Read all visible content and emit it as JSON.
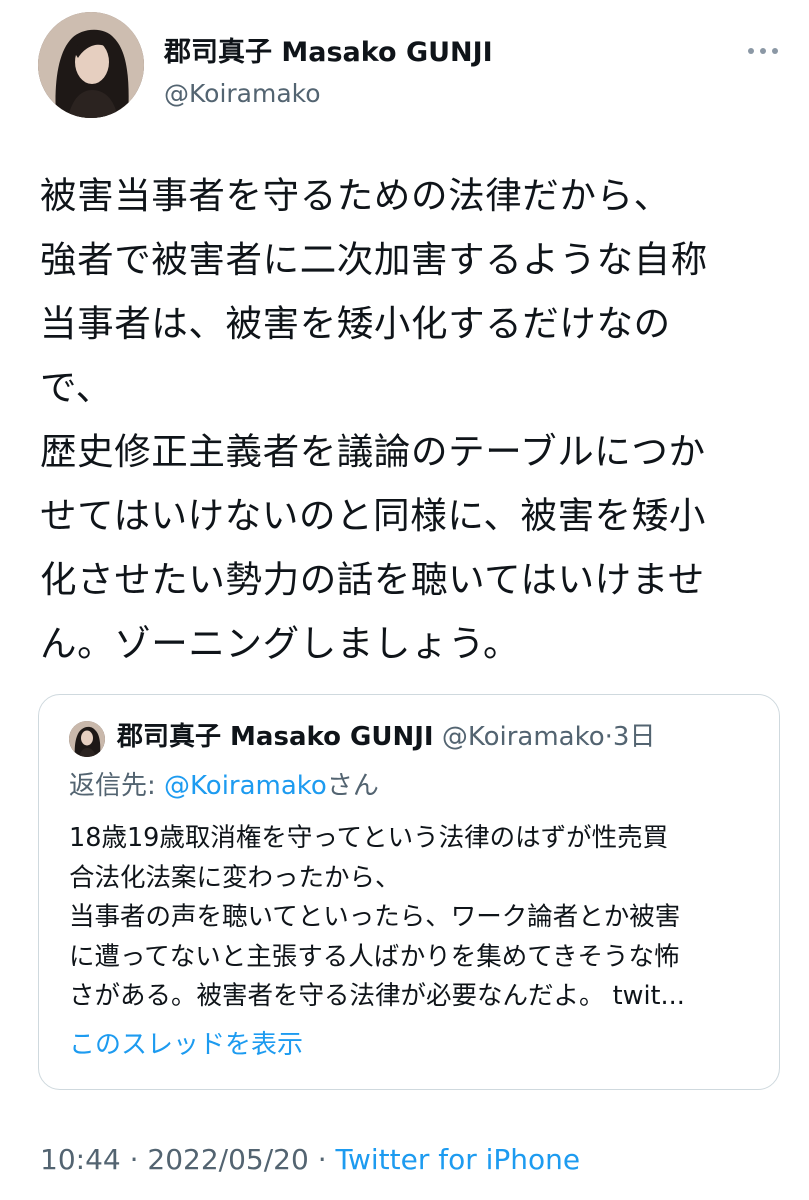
{
  "author": {
    "name": "郡司真子 Masako GUNJI",
    "handle": "@Koiramako"
  },
  "tweet": {
    "text": "被害当事者を守るための法律だから、\n強者で被害者に二次加害するような自称\n当事者は、被害を矮小化するだけなの\nで、\n歴史修正主義者を議論のテーブルにつか\nせてはいけないのと同様に、被害を矮小\n化させたい勢力の話を聴いてはいけませ\nん。ゾーニングしましょう。"
  },
  "quote": {
    "name": "郡司真子 Masako GUNJI",
    "handle": "@Koiramako",
    "separator": "·",
    "time": "3日",
    "reply_prefix": "返信先: ",
    "reply_mention": "@Koiramako",
    "reply_suffix": "さん",
    "text": "18歳19歳取消権を守ってという法律のはずが性売買\n合法化法案に変わったから、\n当事者の声を聴いてといったら、ワーク論者とか被害\nに遭ってないと主張する人ばかりを集めてきそうな怖\nさがある。被害者を守る法律が必要なんだよ。 twit...",
    "show_thread": "このスレッドを表示"
  },
  "footer": {
    "time": "10:44",
    "sep1": " · ",
    "date": "2022/05/20",
    "sep2": " · ",
    "source": "Twitter for iPhone"
  },
  "colors": {
    "text": "#0f1419",
    "secondary": "#536471",
    "link": "#1d9bf0",
    "border": "#cfd9de"
  },
  "icons": {
    "more": "more-horizontal-icon",
    "avatar": "profile-photo"
  }
}
